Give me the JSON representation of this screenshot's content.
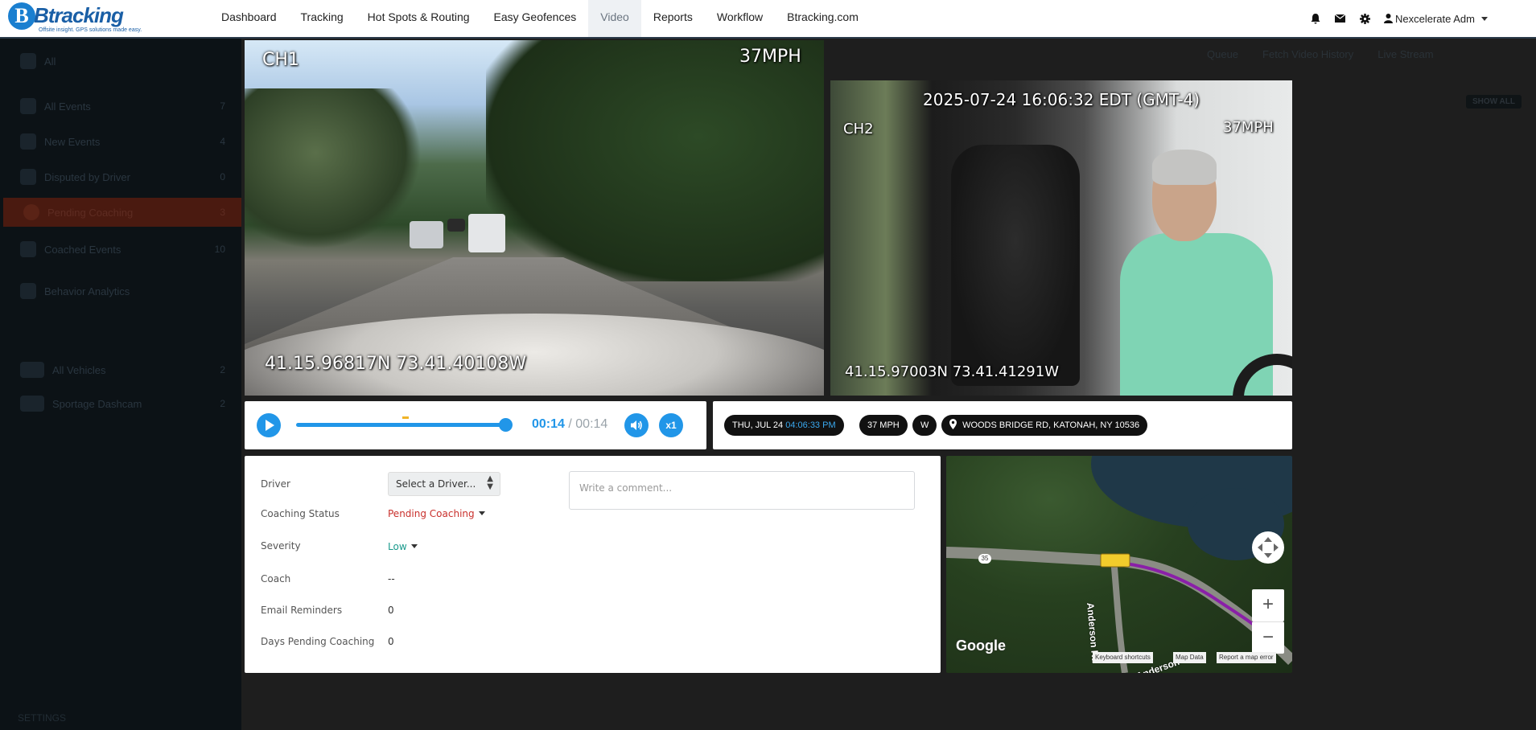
{
  "brand": {
    "name": "Btracking",
    "tagline": "Offsite insight. GPS solutions made easy."
  },
  "nav": {
    "items": [
      "Dashboard",
      "Tracking",
      "Hot Spots & Routing",
      "Easy Geofences",
      "Video",
      "Reports",
      "Workflow",
      "Btracking.com"
    ],
    "active": "Video"
  },
  "user": {
    "name": "Nexcelerate Adm"
  },
  "icons": {
    "bell": "bell-icon",
    "mail": "mail-icon",
    "settings": "gear-icon",
    "user": "user-icon"
  },
  "sidebar": {
    "filter": "All",
    "items": [
      {
        "label": "All Events",
        "count": "7"
      },
      {
        "label": "New Events",
        "count": "4"
      },
      {
        "label": "Disputed by Driver",
        "count": "0"
      },
      {
        "label": "Pending Coaching",
        "count": "3"
      },
      {
        "label": "Coached Events",
        "count": "10"
      },
      {
        "label": "Behavior Analytics",
        "count": ""
      }
    ],
    "vehicles": [
      {
        "label": "All Vehicles",
        "count": "2"
      },
      {
        "label": "Sportage Dashcam",
        "count": "2"
      }
    ],
    "footer": "SETTINGS"
  },
  "toolbar": {
    "queue": "Queue",
    "fetch": "Fetch Video History",
    "live": "Live Stream",
    "show_all": "SHOW ALL"
  },
  "ch1": {
    "label": "CH1",
    "speed": "37MPH",
    "coords": "41.15.96817N 73.41.40108W"
  },
  "ch2": {
    "label": "CH2",
    "speed": "37MPH",
    "timestamp": "2025-07-24 16:06:32 EDT (GMT-4)",
    "coords": "41.15.97003N 73.41.41291W"
  },
  "player": {
    "current": "00:14",
    "separator": "/",
    "total": "00:14",
    "speed": "x1",
    "progress": 1.0
  },
  "event": {
    "date": "THU, JUL 24",
    "time": "04:06:33 PM",
    "speed": "37 MPH",
    "heading": "W",
    "address": "WOODS BRIDGE RD, KATONAH, NY 10536"
  },
  "details": {
    "driver_label": "Driver",
    "driver_value": "Select a Driver...",
    "status_label": "Coaching Status",
    "status_value": "Pending Coaching",
    "severity_label": "Severity",
    "severity_value": "Low",
    "coach_label": "Coach",
    "coach_value": "--",
    "reminders_label": "Email Reminders",
    "reminders_value": "0",
    "days_label": "Days Pending Coaching",
    "days_value": "0",
    "comment_placeholder": "Write a comment..."
  },
  "map": {
    "route_label": "35",
    "road_label": "Anderson Rd",
    "road_label2": "Anderson",
    "google": "Google",
    "shortcuts": "Keyboard shortcuts",
    "map_data": "Map Data",
    "report": "Report a map error",
    "zoom_in": "+",
    "zoom_out": "−"
  },
  "colors": {
    "accent": "#2196e8",
    "pending": "#c9302c",
    "severity_low": "#1a9a8c",
    "route": "#8a1fa8"
  }
}
